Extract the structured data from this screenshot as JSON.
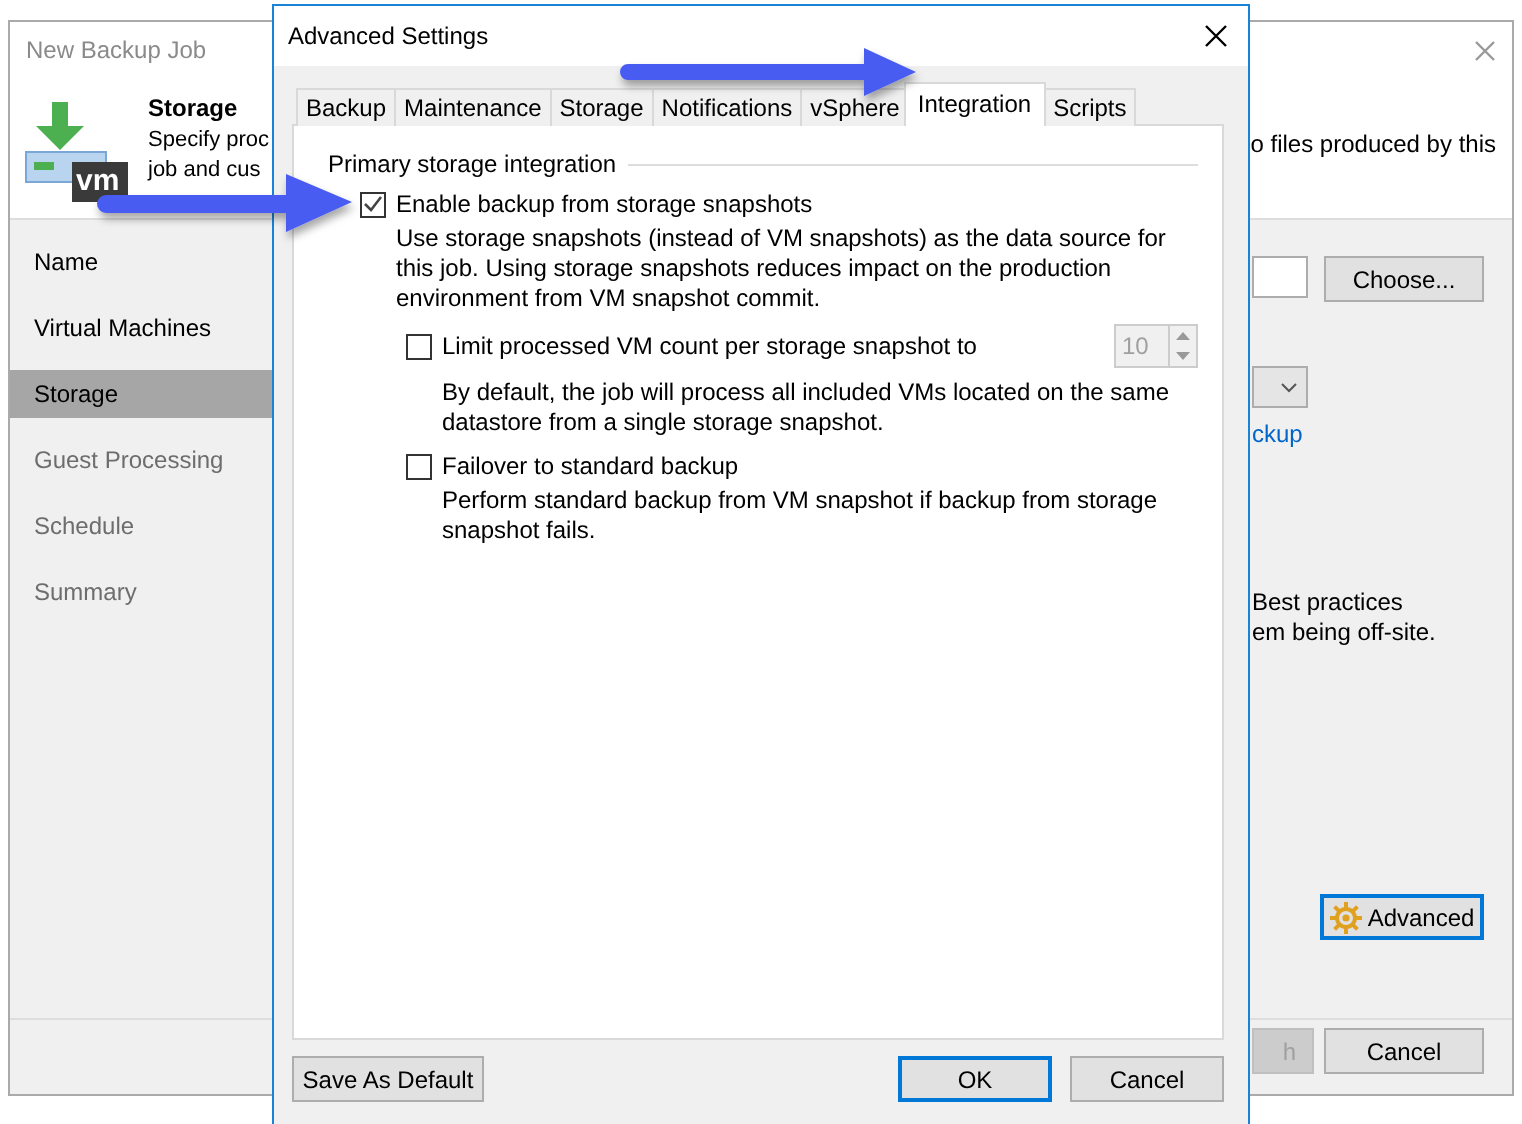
{
  "backup_window": {
    "title": "New Backup Job",
    "header": {
      "icon_text": "vm",
      "title": "Storage",
      "description_left": [
        "Specify proc",
        "job and cus"
      ],
      "description_right": "o files produced by this"
    },
    "steps": [
      {
        "label": "Name",
        "selected": false,
        "disabled": false
      },
      {
        "label": "Virtual Machines",
        "selected": false,
        "disabled": false
      },
      {
        "label": "Storage",
        "selected": true,
        "disabled": false
      },
      {
        "label": "Guest Processing",
        "selected": false,
        "disabled": true
      },
      {
        "label": "Schedule",
        "selected": false,
        "disabled": true
      },
      {
        "label": "Summary",
        "selected": false,
        "disabled": true
      }
    ],
    "right_panel": {
      "choose_button": "Choose...",
      "link": "ckup",
      "notes": [
        "Best practices",
        "em being off-site."
      ],
      "advanced_button": "Advanced"
    },
    "footer_buttons": [
      {
        "label": "h",
        "disabled": true
      },
      {
        "label": "Cancel",
        "disabled": false
      }
    ]
  },
  "dialog": {
    "title": "Advanced Settings",
    "tabs": [
      {
        "label": "Backup",
        "selected": false
      },
      {
        "label": "Maintenance",
        "selected": false
      },
      {
        "label": "Storage",
        "selected": false
      },
      {
        "label": "Notifications",
        "selected": false
      },
      {
        "label": "vSphere",
        "selected": false
      },
      {
        "label": "Integration",
        "selected": true
      },
      {
        "label": "Scripts",
        "selected": false
      }
    ],
    "group_label": "Primary storage integration",
    "options": [
      {
        "label": "Enable backup from storage snapshots",
        "checked": true,
        "description": "Use storage snapshots (instead of VM snapshots) as the data source for this job. Using storage snapshots reduces impact on the production environment from VM snapshot commit.",
        "children": [
          {
            "label": "Limit processed VM count per storage snapshot to",
            "checked": false,
            "spin": {
              "value": "10",
              "disabled": true
            },
            "description": "By default, the job will process all included VMs located on the same datastore from a single storage snapshot."
          },
          {
            "label": "Failover to standard backup",
            "checked": false,
            "description": "Perform standard backup from VM snapshot if backup from storage snapshot fails."
          }
        ]
      }
    ],
    "buttons": [
      {
        "label": "Save As Default",
        "kind": "left",
        "default": false
      },
      {
        "label": "OK",
        "kind": "right",
        "default": true
      },
      {
        "label": "Cancel",
        "kind": "right",
        "default": false
      }
    ]
  }
}
